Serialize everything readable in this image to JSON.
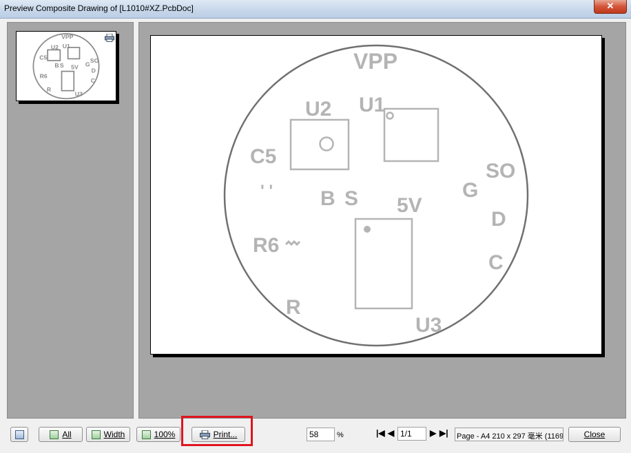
{
  "window": {
    "title": "Preview Composite Drawing of [L1010#XZ.PcbDoc]",
    "close_glyph": "✕"
  },
  "drawing": {
    "labels": {
      "vpp": "VPP",
      "u2": "U2",
      "u1": "U1",
      "c5": "C5",
      "c5_mark": "' '",
      "so": "SO",
      "g": "G",
      "b": "B",
      "s": "S",
      "v5": "5V",
      "d": "D",
      "r6": "R6",
      "c": "C",
      "r": "R",
      "u3": "U3"
    }
  },
  "toolbar": {
    "all_label": "All",
    "width_label": "Width",
    "hundred_label": "100%",
    "print_label": "Print...",
    "zoom_value": "58",
    "zoom_unit": "%",
    "page_value": "1/1",
    "page_status": "Page - A4 210 x 297 毫米 (1169",
    "close_label": "Close",
    "nav_first": "|◀",
    "nav_prev": "◀",
    "nav_next": "▶",
    "nav_last": "▶|"
  },
  "colors": {
    "highlight": "#e0141e",
    "silkscreen": "#b4b4b4",
    "outline": "#707070"
  },
  "icons": {
    "close": "close-icon",
    "print": "printer-icon",
    "pages": "page-view-icon"
  }
}
